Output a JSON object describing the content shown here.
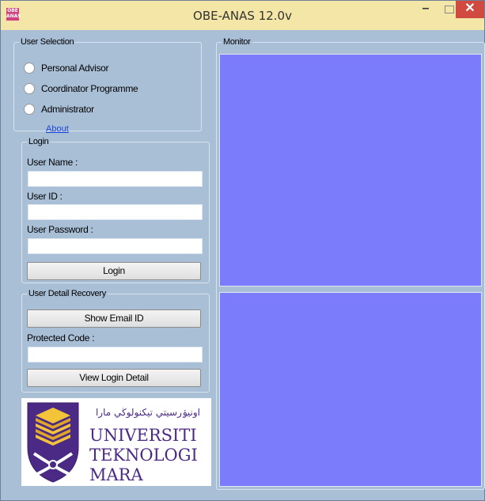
{
  "window": {
    "title": "OBE-ANAS 12.0v",
    "app_icon_text": "OBE ANAS",
    "minimize_glyph": "–",
    "close_glyph": "✕"
  },
  "user_selection": {
    "legend": "User Selection",
    "options": [
      "Personal Advisor",
      "Coordinator Programme",
      "Administrator"
    ],
    "about_link": "About"
  },
  "login": {
    "legend": "Login",
    "username_label": "User Name :",
    "userid_label": "User ID :",
    "password_label": "User Password :",
    "login_button": "Login"
  },
  "recovery": {
    "legend": "User Detail Recovery",
    "show_email_button": "Show Email ID",
    "protected_code_label": "Protected Code :",
    "view_login_button": "View Login Detail"
  },
  "logo": {
    "jawi_text": "اونيۏرسيتي تيکنولوڬي مارا",
    "line1": "UNIVERSITI",
    "line2": "TEKNOLOGI",
    "line3": "MARA"
  },
  "monitor": {
    "legend": "Monitor"
  },
  "colors": {
    "monitor_panel": "#7b7cfc",
    "form_background": "#a9bfd6",
    "title_bar": "#f4e6a6",
    "close_button": "#d04a3f",
    "link": "#1d44d8"
  }
}
